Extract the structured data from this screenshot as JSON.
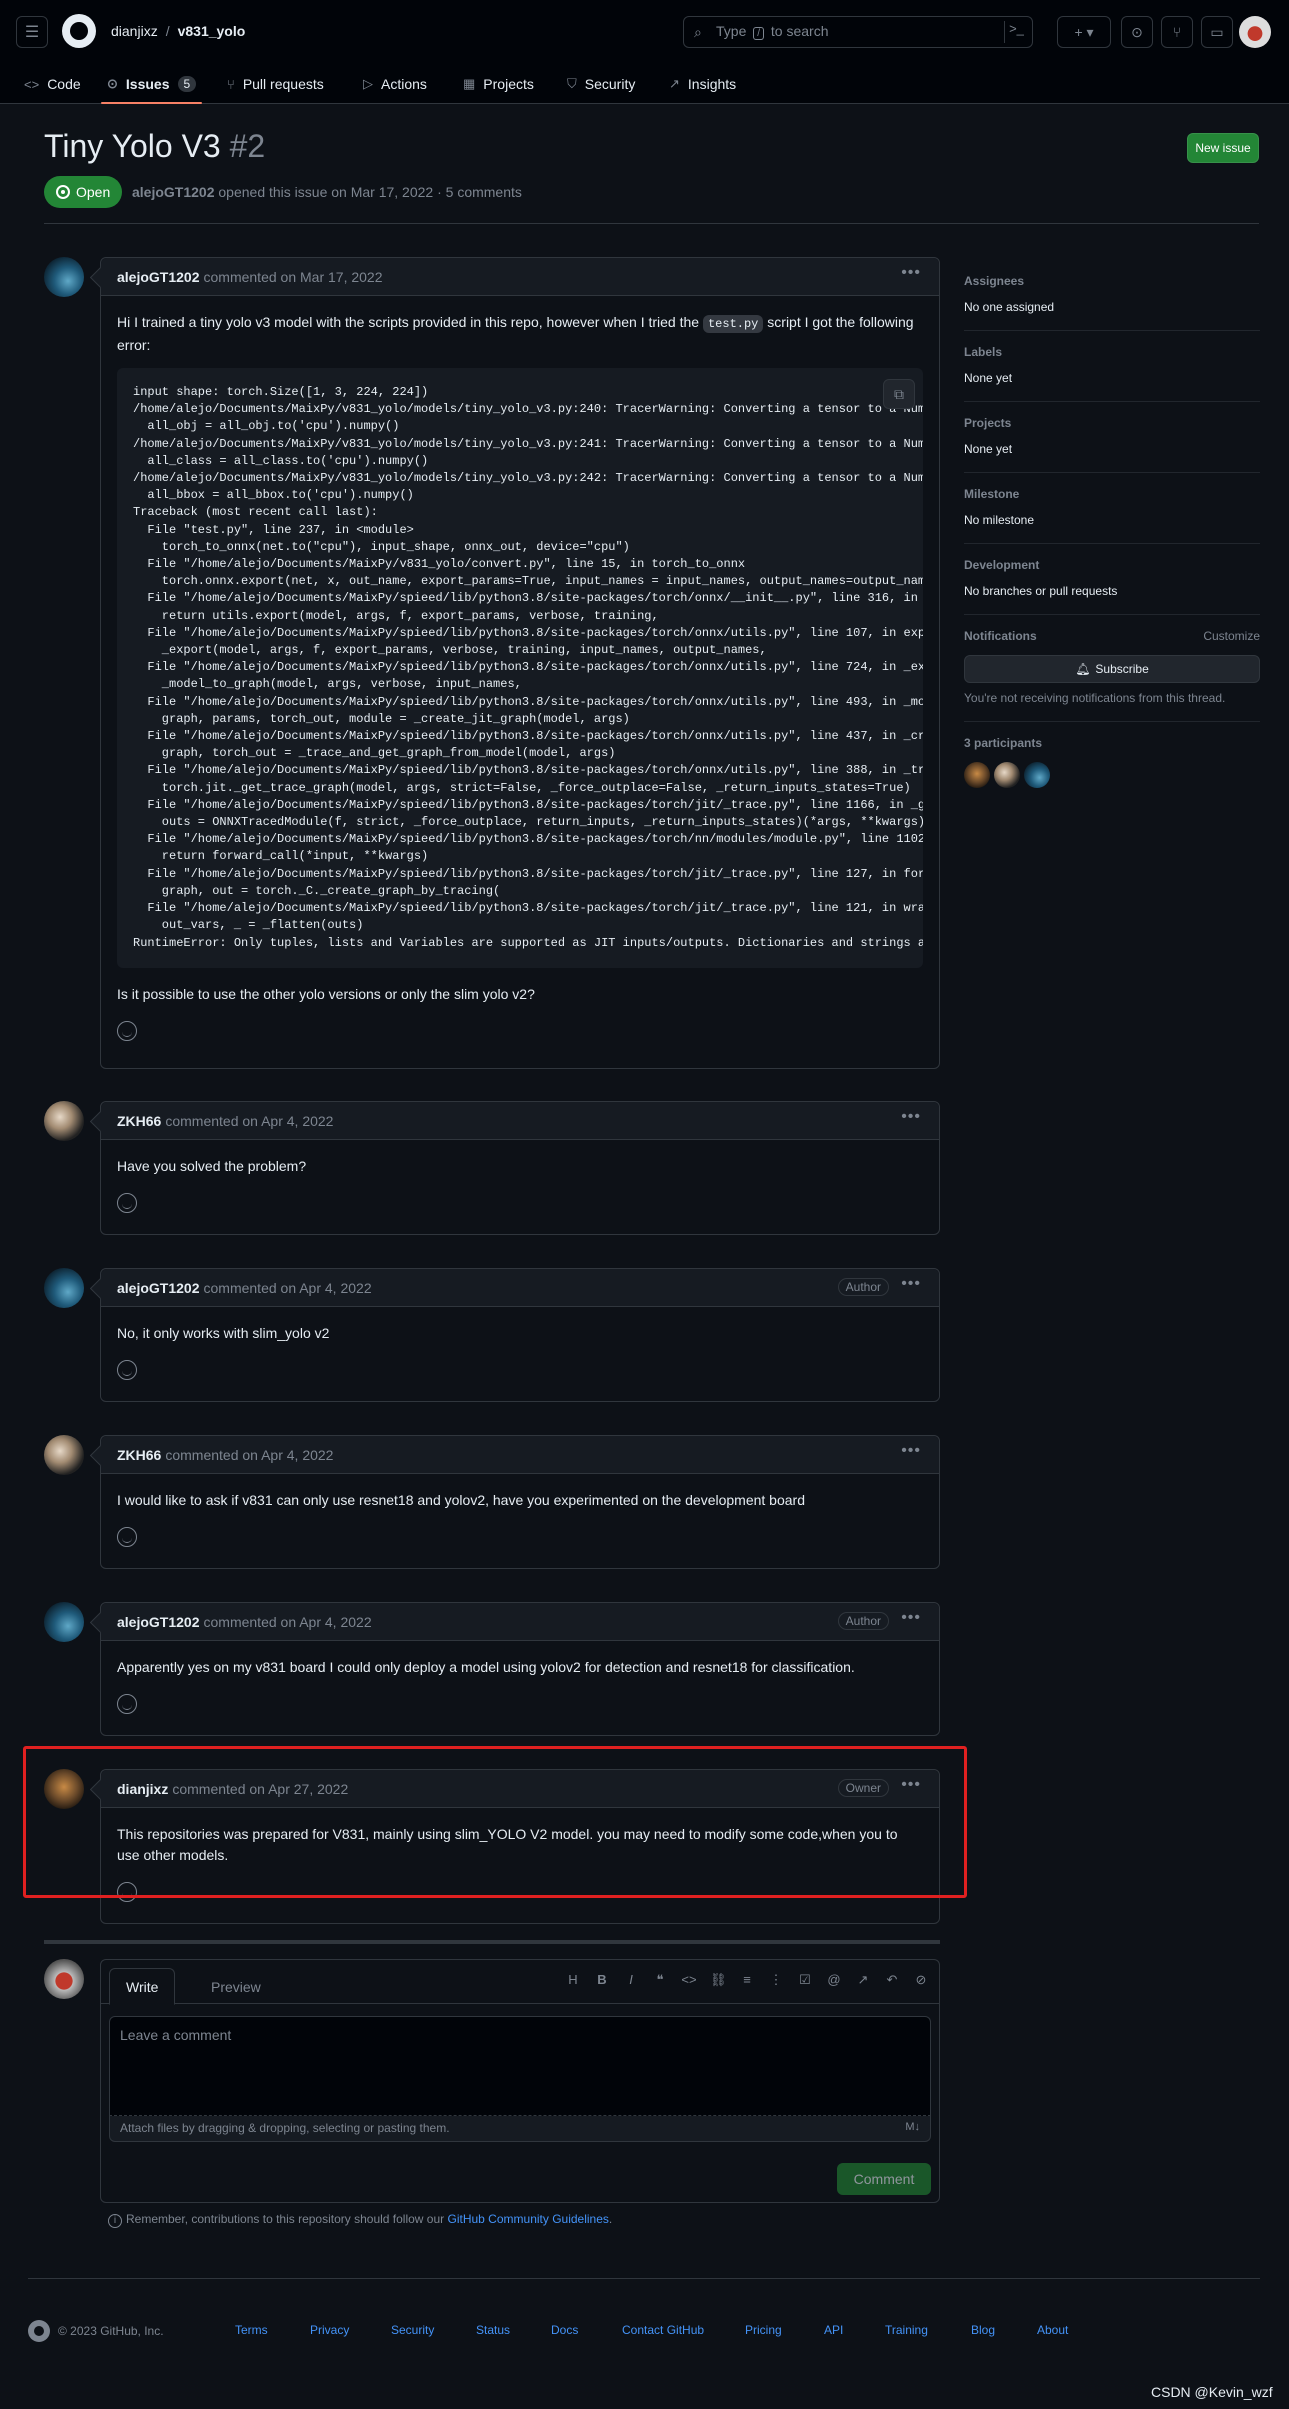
{
  "header": {
    "owner": "dianjixz",
    "repo": "v831_yolo",
    "search_prefix": "Type",
    "search_key": "/",
    "search_suffix": "to search",
    "tabs": [
      {
        "label": "Code"
      },
      {
        "label": "Issues",
        "count": "5"
      },
      {
        "label": "Pull requests"
      },
      {
        "label": "Actions"
      },
      {
        "label": "Projects"
      },
      {
        "label": "Security"
      },
      {
        "label": "Insights"
      }
    ]
  },
  "issue": {
    "title": "Tiny Yolo V3",
    "number": "#2",
    "new_issue_label": "New issue",
    "state": "Open",
    "author": "alejoGT1202",
    "meta": "opened this issue on Mar 17, 2022 · 5 comments"
  },
  "comments": [
    {
      "author": "alejoGT1202",
      "date": "commented on Mar 17, 2022",
      "badge": "",
      "text_before": "Hi I trained a tiny yolo v3 model with the scripts provided in this repo, however when I tried the",
      "inline_code": "test.py",
      "text_after": "script I got the following error:",
      "code": "input shape: torch.Size([1, 3, 224, 224])\n/home/alejo/Documents/MaixPy/v831_yolo/models/tiny_yolo_v3.py:240: TracerWarning: Converting a tensor to a NumPy\n  all_obj = all_obj.to('cpu').numpy()\n/home/alejo/Documents/MaixPy/v831_yolo/models/tiny_yolo_v3.py:241: TracerWarning: Converting a tensor to a NumPy\n  all_class = all_class.to('cpu').numpy()\n/home/alejo/Documents/MaixPy/v831_yolo/models/tiny_yolo_v3.py:242: TracerWarning: Converting a tensor to a NumPy\n  all_bbox = all_bbox.to('cpu').numpy()\nTraceback (most recent call last):\n  File \"test.py\", line 237, in <module>\n    torch_to_onnx(net.to(\"cpu\"), input_shape, onnx_out, device=\"cpu\")\n  File \"/home/alejo/Documents/MaixPy/v831_yolo/convert.py\", line 15, in torch_to_onnx\n    torch.onnx.export(net, x, out_name, export_params=True, input_names = input_names, output_names=output_names\n  File \"/home/alejo/Documents/MaixPy/spieed/lib/python3.8/site-packages/torch/onnx/__init__.py\", line 316, in e\n    return utils.export(model, args, f, export_params, verbose, training,\n  File \"/home/alejo/Documents/MaixPy/spieed/lib/python3.8/site-packages/torch/onnx/utils.py\", line 107, in expo\n    _export(model, args, f, export_params, verbose, training, input_names, output_names,\n  File \"/home/alejo/Documents/MaixPy/spieed/lib/python3.8/site-packages/torch/onnx/utils.py\", line 724, in _exp\n    _model_to_graph(model, args, verbose, input_names,\n  File \"/home/alejo/Documents/MaixPy/spieed/lib/python3.8/site-packages/torch/onnx/utils.py\", line 493, in _mod\n    graph, params, torch_out, module = _create_jit_graph(model, args)\n  File \"/home/alejo/Documents/MaixPy/spieed/lib/python3.8/site-packages/torch/onnx/utils.py\", line 437, in _cre\n    graph, torch_out = _trace_and_get_graph_from_model(model, args)\n  File \"/home/alejo/Documents/MaixPy/spieed/lib/python3.8/site-packages/torch/onnx/utils.py\", line 388, in _tra\n    torch.jit._get_trace_graph(model, args, strict=False, _force_outplace=False, _return_inputs_states=True)\n  File \"/home/alejo/Documents/MaixPy/spieed/lib/python3.8/site-packages/torch/jit/_trace.py\", line 1166, in _ge\n    outs = ONNXTracedModule(f, strict, _force_outplace, return_inputs, _return_inputs_states)(*args, **kwargs)\n  File \"/home/alejo/Documents/MaixPy/spieed/lib/python3.8/site-packages/torch/nn/modules/module.py\", line 1102,\n    return forward_call(*input, **kwargs)\n  File \"/home/alejo/Documents/MaixPy/spieed/lib/python3.8/site-packages/torch/jit/_trace.py\", line 127, in forw\n    graph, out = torch._C._create_graph_by_tracing(\n  File \"/home/alejo/Documents/MaixPy/spieed/lib/python3.8/site-packages/torch/jit/_trace.py\", line 121, in wrap\n    out_vars, _ = _flatten(outs)\nRuntimeError: Only tuples, lists and Variables are supported as JIT inputs/outputs. Dictionaries and strings ar",
      "text_end": "Is it possible to use the other yolo versions or only the slim yolo v2?"
    },
    {
      "author": "ZKH66",
      "date": "commented on Apr 4, 2022",
      "badge": "",
      "text": "Have you solved the problem?"
    },
    {
      "author": "alejoGT1202",
      "date": "commented on Apr 4, 2022",
      "badge": "Author",
      "text": "No, it only works with slim_yolo v2"
    },
    {
      "author": "ZKH66",
      "date": "commented on Apr 4, 2022",
      "badge": "",
      "text": "I would like to ask if v831 can only use resnet18 and yolov2, have you experimented on the development board"
    },
    {
      "author": "alejoGT1202",
      "date": "commented on Apr 4, 2022",
      "badge": "Author",
      "text": "Apparently yes on my v831 board I could only deploy a model using yolov2 for detection and resnet18 for classification."
    },
    {
      "author": "dianjixz",
      "date": "commented on Apr 27, 2022",
      "badge": "Owner",
      "text": "This repositories was prepared for V831, mainly using slim_YOLO V2 model. you may need to modify some code,when you to use other models."
    }
  ],
  "sidebar": {
    "assignees_h": "Assignees",
    "assignees_v": "No one assigned",
    "labels_h": "Labels",
    "labels_v": "None yet",
    "projects_h": "Projects",
    "projects_v": "None yet",
    "milestone_h": "Milestone",
    "milestone_v": "No milestone",
    "development_h": "Development",
    "development_v": "No branches or pull requests",
    "notifications_h": "Notifications",
    "customize": "Customize",
    "subscribe": "Subscribe",
    "notif_hint": "You're not receiving notifications from this thread.",
    "participants_h": "3 participants"
  },
  "composer": {
    "write": "Write",
    "preview": "Preview",
    "placeholder": "Leave a comment",
    "attach": "Attach files by dragging & dropping, selecting or pasting them.",
    "submit": "Comment",
    "remember_prefix": "Remember, contributions to this repository should follow our",
    "remember_link": "GitHub Community Guidelines",
    "remember_suffix": "."
  },
  "footer": {
    "copyright": "© 2023 GitHub, Inc.",
    "links": [
      "Terms",
      "Privacy",
      "Security",
      "Status",
      "Docs",
      "Contact GitHub",
      "Pricing",
      "API",
      "Training",
      "Blog",
      "About"
    ]
  },
  "watermark": "CSDN @Kevin_wzf"
}
